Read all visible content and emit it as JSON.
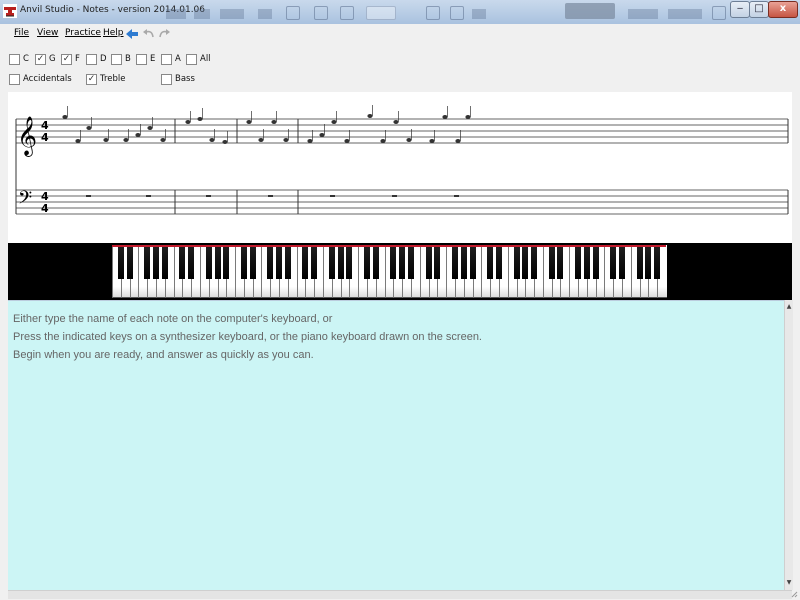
{
  "window": {
    "title": "Anvil Studio - Notes - version 2014.01.06",
    "minimize_glyph": "‒",
    "maximize_glyph": "□",
    "close_glyph": "x",
    "app_icon": "anvil-icon"
  },
  "menu": {
    "items": [
      {
        "label": "File"
      },
      {
        "label": "View"
      },
      {
        "label": "Practice"
      },
      {
        "label": "Help"
      }
    ],
    "toolbar_icons": [
      "back-arrow-icon",
      "undo-icon",
      "redo-icon"
    ]
  },
  "note_options": [
    {
      "label": "C",
      "checked": false
    },
    {
      "label": "G",
      "checked": true
    },
    {
      "label": "F",
      "checked": true
    },
    {
      "label": "D",
      "checked": false
    },
    {
      "label": "B",
      "checked": false
    },
    {
      "label": "E",
      "checked": false
    },
    {
      "label": "A",
      "checked": false
    },
    {
      "label": "All",
      "checked": false
    }
  ],
  "clef_options": [
    {
      "label": "Accidentals",
      "checked": false
    },
    {
      "label": "Treble",
      "checked": true
    },
    {
      "label": "Bass",
      "checked": false
    }
  ],
  "check_glyph": "✓",
  "staff": {
    "treble_clef": "𝄞",
    "bass_clef": "𝄢",
    "time_signature_top": "4",
    "time_signature_bottom": "4"
  },
  "keyboard": {
    "white_key_count": 63
  },
  "instructions": {
    "line1": "Either type the name of each note on the computer's keyboard, or",
    "line2": "Press the indicated keys on a synthesizer keyboard, or the piano keyboard drawn on the screen.",
    "line3": "Begin when you are ready, and answer as quickly as you can."
  },
  "colors": {
    "instructions_bg": "#ccf5f5",
    "keyboard_red": "#c21b2d",
    "toolbar_arrow": "#2e7bd1"
  }
}
